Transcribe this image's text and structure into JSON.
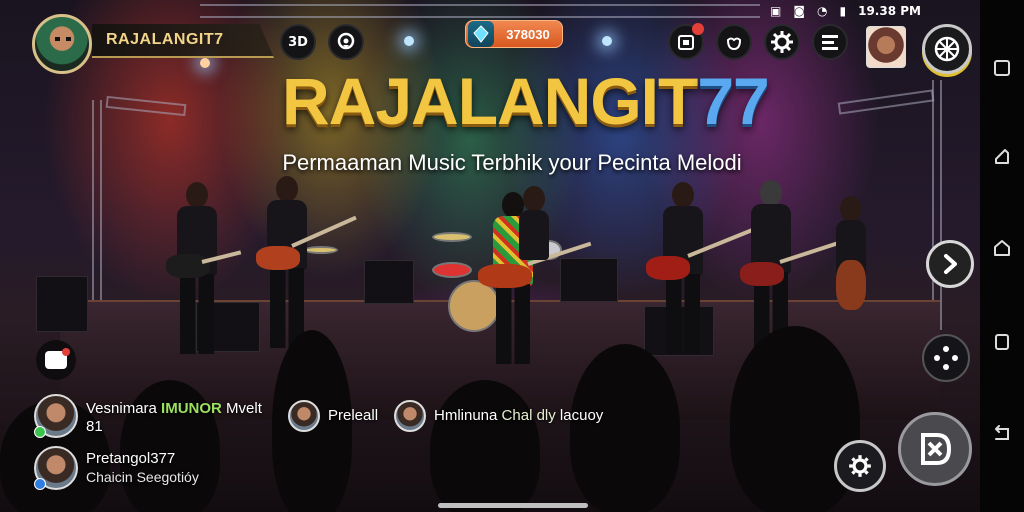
{
  "player": {
    "name": "RAJALANGIT7"
  },
  "hud": {
    "mode_chip": "3D",
    "currency_value": "378030",
    "currency_color": "#e06a2e"
  },
  "status_bar": {
    "time": "19.38 PM"
  },
  "title": {
    "main": "RAJALANGIT",
    "accent": "77",
    "subtitle": "Permaaman Music Terbhik your Pecinta Melodi"
  },
  "colors": {
    "title_gold": "#f2c640",
    "title_blue": "#5aa8f0",
    "chat_highlight": "#9be060"
  },
  "chat": {
    "row1": {
      "user": "Vesnimara",
      "highlight": "IMUNOR",
      "text": "Mvelt",
      "line2": "81"
    },
    "row2": {
      "user": "Preleall"
    },
    "row3": {
      "user": "Hmlinuna",
      "highlight": "Chal dly",
      "text": "lacuoy"
    },
    "row4": {
      "user": "Pretangol",
      "highlight": "377",
      "line2": "Chaicin Seegotióy"
    }
  },
  "icons": {
    "top": [
      "3d-view-icon",
      "location-pin-icon",
      "gem-icon",
      "calendar-icon",
      "bag-icon",
      "settings-gear-icon",
      "menu-list-icon",
      "wheel-icon"
    ],
    "right": [
      "arrow-right-icon",
      "dpad-icon",
      "gear-icon",
      "action-icon"
    ],
    "navbar": [
      "square-icon",
      "back-icon",
      "home-icon",
      "recents-icon",
      "rotate-icon"
    ]
  }
}
